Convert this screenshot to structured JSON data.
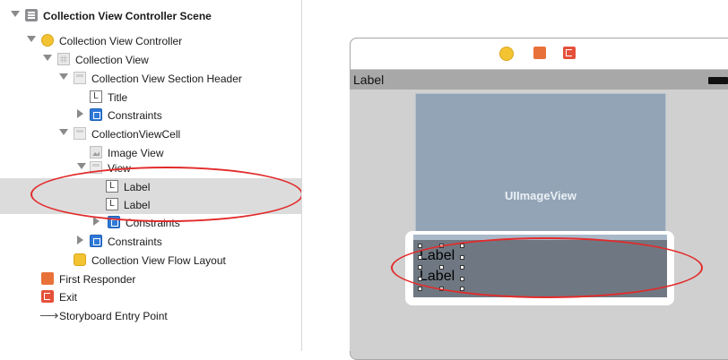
{
  "outline": {
    "items": [
      {
        "label": "Collection View Controller Scene",
        "icon": "scene-icon"
      },
      {
        "label": "Collection View Controller",
        "icon": "view-controller-icon"
      },
      {
        "label": "Collection View",
        "icon": "collection-view-icon"
      },
      {
        "label": "Collection View Section Header",
        "icon": "section-header-icon"
      },
      {
        "label": "Title",
        "icon": "label-icon",
        "icon_glyph": "L"
      },
      {
        "label": "Constraints",
        "icon": "constraints-icon"
      },
      {
        "label": "CollectionViewCell",
        "icon": "cell-icon"
      },
      {
        "label": "Image View",
        "icon": "image-view-icon"
      },
      {
        "label": "View",
        "icon": "view-icon"
      },
      {
        "label": "Label",
        "icon": "label-icon",
        "icon_glyph": "L"
      },
      {
        "label": "Label",
        "icon": "label-icon",
        "icon_glyph": "L"
      },
      {
        "label": "Constraints",
        "icon": "constraints-icon"
      },
      {
        "label": "Constraints",
        "icon": "constraints-icon"
      },
      {
        "label": "Collection View Flow Layout",
        "icon": "flow-layout-icon"
      },
      {
        "label": "First Responder",
        "icon": "first-responder-icon"
      },
      {
        "label": "Exit",
        "icon": "exit-icon"
      },
      {
        "label": "Storyboard Entry Point",
        "icon": "arrow-right-icon",
        "icon_glyph": "⟶"
      }
    ]
  },
  "canvas": {
    "navbar_label": "Label",
    "image_view_label": "UIImageView",
    "cell_labels": [
      "Label",
      "Label"
    ]
  },
  "colors": {
    "annotation": "#e22b2b",
    "selection": "#dcdcdc",
    "image_view": "#93a4b6",
    "cell_content": "#6f7882"
  }
}
